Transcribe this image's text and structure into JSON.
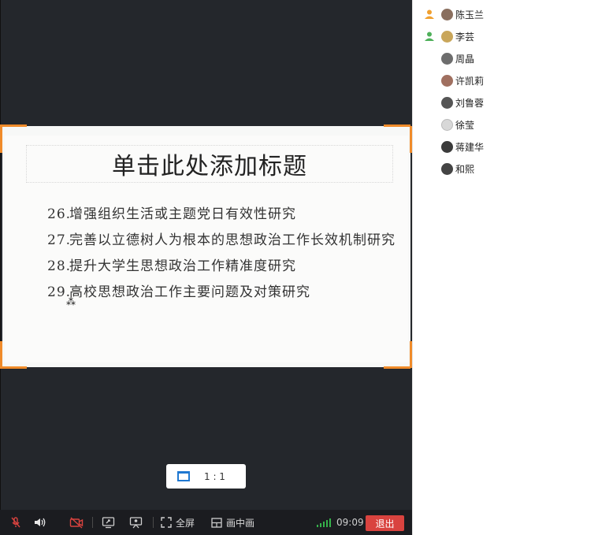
{
  "slide": {
    "title": "单击此处添加标题",
    "items": [
      {
        "num": "26.",
        "text": "增强组织生活或主题党日有效性研究"
      },
      {
        "num": "27.",
        "text": "完善以立德树人为根本的思想政治工作长效机制研究"
      },
      {
        "num": "28.",
        "text": "提升大学生思想政治工作精准度研究"
      },
      {
        "num": "29.",
        "text": "高校思想政治工作主要问题及对策研究"
      }
    ]
  },
  "ratio_popup": {
    "label": "1 : 1"
  },
  "toolbar": {
    "fullscreen_label": "全屏",
    "pip_label": "画中画",
    "time": "09:09",
    "exit_label": "退出"
  },
  "participants": [
    {
      "name": "陈玉兰",
      "role": "host",
      "avatar_color": "#8a6f5f"
    },
    {
      "name": "李芸",
      "role": "host",
      "avatar_color": "#c9a65a"
    },
    {
      "name": "周晶",
      "role": "member",
      "avatar_color": "#6d6d6d"
    },
    {
      "name": "许凯莉",
      "role": "member",
      "avatar_color": "#a07060"
    },
    {
      "name": "刘鲁蓉",
      "role": "member",
      "avatar_color": "#555555"
    },
    {
      "name": "徐莹",
      "role": "member",
      "avatar_color": "#d8d8d8"
    },
    {
      "name": "蒋建华",
      "role": "member",
      "avatar_color": "#3b3b3b"
    },
    {
      "name": "和熙",
      "role": "member",
      "avatar_color": "#444444"
    }
  ],
  "colors": {
    "accent_orange": "#f08b2a",
    "exit_red": "#d9433f",
    "signal_green": "#35b24a",
    "host_icon": "#f0a030",
    "member_icon": "#4fb05a"
  }
}
